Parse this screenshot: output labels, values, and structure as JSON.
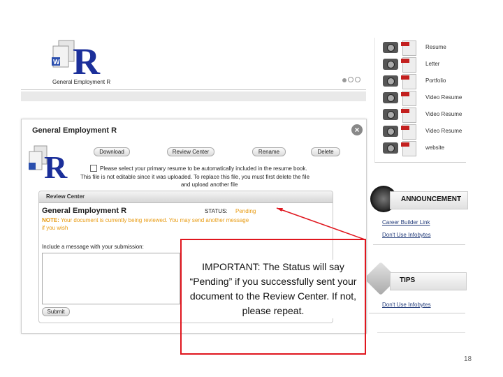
{
  "top_panel": {
    "title": "General Employment R"
  },
  "right_panel": {
    "items": [
      {
        "label": "Resume"
      },
      {
        "label": "Letter"
      },
      {
        "label": "Portfolio"
      },
      {
        "label": "Video Resume"
      },
      {
        "label": "Video Resume"
      },
      {
        "label": "Video Resume"
      },
      {
        "label": "website"
      }
    ],
    "announcements": {
      "title": "ANNOUNCEMENT",
      "links": [
        "Career Builder Link",
        "Don't Use Infobytes"
      ]
    },
    "tips": {
      "title": "TIPS",
      "links": [
        "Don't Use Infobytes"
      ]
    }
  },
  "dialog": {
    "title": "General Employment R",
    "buttons": {
      "download": "Download",
      "review_center": "Review Center",
      "rename": "Rename",
      "delete": "Delete"
    },
    "checkbox_label": "Please select your primary resume to be automatically included in the resume book.",
    "warning_line1": "This file is not editable since it was uploaded. To replace this file, you must first delete the file",
    "warning_line2": "and upload another file",
    "review": {
      "header": "Review Center",
      "doc_title": "General Employment R",
      "status_label": "STATUS:",
      "status_value": "Pending",
      "note_label": "NOTE:",
      "note_text": "Your document is currently being reviewed. You may send another message",
      "note_text2": "if you wish",
      "message_label": "Include a message with your submission:",
      "submit": "Submit"
    }
  },
  "callout": {
    "text": "IMPORTANT: The Status will say “Pending” if you successfully sent your document to the Review Center. If not, please repeat.",
    "color": "#e0161e"
  },
  "page_number": "18"
}
